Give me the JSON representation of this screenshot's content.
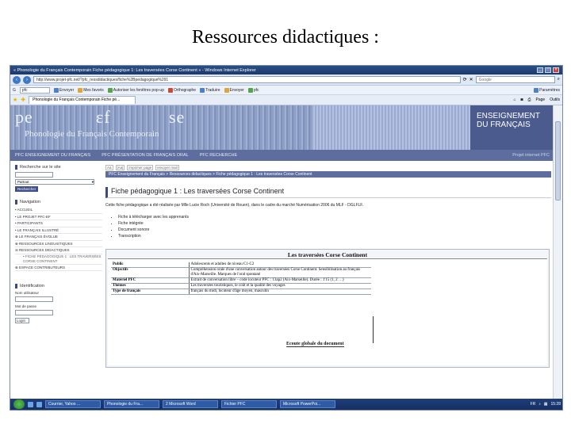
{
  "slide": {
    "title": "Ressources didactiques :"
  },
  "browser": {
    "window_title": "« Phonologie du Français Contemporain Fiche pédagogique 1: Les traversées Corse Continent » - Windows Internet Explorer",
    "url": "http://www.projet-pfc.net/?pfc_ressdidactiques/fiche%2Bpedagogique%291",
    "search_placeholder": "Google",
    "toolbar": {
      "google_value": "pfc",
      "items": [
        "Envoyer",
        "Mes favoris",
        "Autoriser les fenêtres pop-up",
        "Orthographe",
        "Traduire",
        "Envoyer",
        "pfc"
      ],
      "params": "Paramètres"
    },
    "tab_label": "Phonologie du Français Contemporain Fiche pé...",
    "right_tools": [
      "Page",
      "Outils"
    ]
  },
  "site": {
    "logo": {
      "pe": "pe",
      "ef": "εf",
      "se": "se",
      "subtitle": "Phonologie du Français Contemporain"
    },
    "section_title_line1": "ENSEIGNEMENT",
    "section_title_line2": "DU FRANÇAIS",
    "nav": [
      "PFC ENSEIGNEMENT DU FRANÇAIS",
      "PFC PRÉSENTATION DE FRANÇAIS ORAL",
      "PFC RECHERCHE"
    ],
    "nav_right": "Projet internet PFC"
  },
  "sidebar": {
    "search_head": "Recherche sur le site",
    "search_select": "Partout",
    "search_button": "Rechercher",
    "nav_head": "Navigation",
    "nav_items": [
      "ACCUEIL",
      "LE PROJET PFC-EF",
      "PARTICIPANTS",
      "LE FRANÇAIS ILLUSTRÉ",
      "LE FRANÇAIS ÉVOLUE",
      "RESSOURCES LINGUISTIQUES",
      "RESSOURCES DIDACTIQUES",
      "FICHE PÉDAGOGIQUE 1 : LES TRAVERSÉES CORSE CONTINENT",
      "ESPACE CONTRIBUTEURS"
    ],
    "login_head": "Identification",
    "login_user_label": "Nom utilisateur",
    "login_pass_label": "Mot de passe",
    "login_button": "Login"
  },
  "main": {
    "tools": [
      "Aa",
      "|Aa|",
      "imprimer page",
      "envoyer mail"
    ],
    "breadcrumb": "PFC Enseignement du Français > Ressources didactiques > Fiche pédagogique 1 : Les traversées Corse Continent",
    "page_title": "Fiche pédagogique 1 : Les traversées Corse Continent",
    "intro": "Cette fiche pédagogique a été réalisée par Mlle Lucie Roch (Université de Rouen), dans le cadre du marché Numérisation 2006 du MLF - DGLFLF.",
    "bullets": [
      "Fiche à télécharger avec les apprenants",
      "Fiche intégrée",
      "Document sonore",
      "Transcription"
    ],
    "doc": {
      "title": "Les traversées Corse Continent",
      "rows": [
        {
          "k": "Public",
          "v": "Adolescents et adultes de niveau C1-C2"
        },
        {
          "k": "Objectifs",
          "v": "Compréhension orale d'une conversation autour des traversées Corse Continent. Sensibilisation au français d'Aix-Marseille. Marques de l'oral spontané"
        },
        {
          "k": "Matériel PFC",
          "v": "Extrait de conversation libre – code locuteur PFC : 13ap2 (Aix-Marseille). Durée : 1'15 (1, 2 …)"
        },
        {
          "k": "Thèmes",
          "v": "Les traversées touristiques, le coût et la qualité des voyages"
        },
        {
          "k": "Type de français",
          "v": "français du midi, locuteur d'âge moyen, masculin"
        }
      ],
      "ecoute": "Ecoute globale du document"
    }
  },
  "taskbar": {
    "tasks": [
      "Courrier, Yahoo ...",
      "Phonologie du Fra...",
      "2 Microsoft Word",
      "Fichier PFC",
      "Microsoft PowerPoi..."
    ],
    "lang": "FR",
    "clock": "15:28"
  },
  "colors": {
    "nav_bg": "#5d6d9d",
    "banner_right": "#4b5b8e",
    "chrome": "#dfe8f5"
  }
}
